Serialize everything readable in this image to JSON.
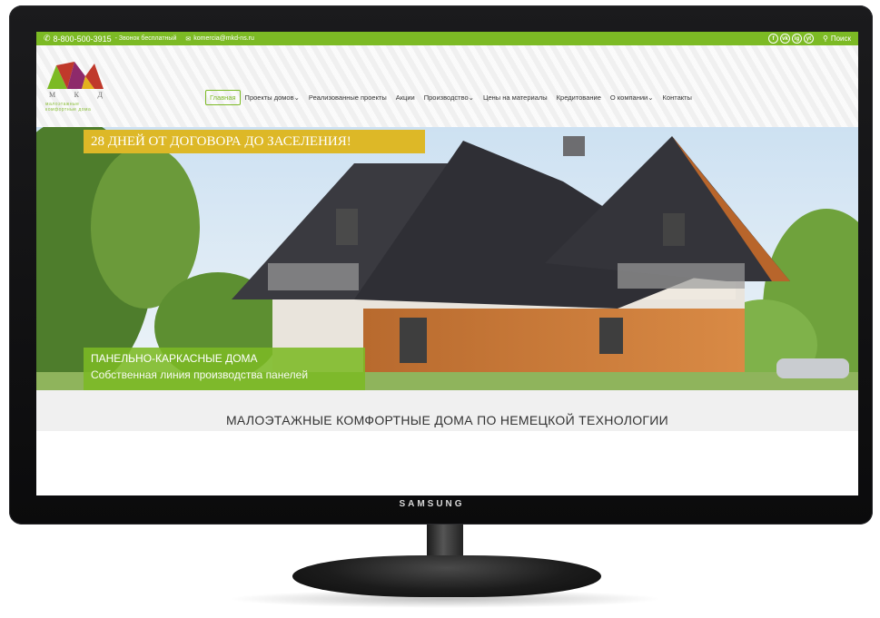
{
  "topbar": {
    "phone": "8-800-500-3915",
    "free_call": "- Звонок бесплатный",
    "email": "komercia@mkd-ns.ru",
    "social": [
      "f",
      "vk",
      "ig",
      "yt"
    ],
    "search_label": "Поиск"
  },
  "logo": {
    "letters": [
      "М",
      "К",
      "Д"
    ],
    "subtitle_line1": "малоэтажные",
    "subtitle_line2": "комфортные дома"
  },
  "nav": {
    "items": [
      {
        "label": "Главная"
      },
      {
        "label": "Проекты домов"
      },
      {
        "label": "Реализованные проекты"
      },
      {
        "label": "Акции"
      },
      {
        "label": "Производство"
      },
      {
        "label": "Цены на материалы"
      },
      {
        "label": "Кредитование"
      },
      {
        "label": "О компании"
      },
      {
        "label": "Контакты"
      }
    ],
    "dropdown_mark": "⌄"
  },
  "hero": {
    "banner_top": "28 ДНЕЙ ОТ ДОГОВОРА ДО ЗАСЕЛЕНИЯ!",
    "banner_line1": "ПАНЕЛЬНО-КАРКАСНЫЕ ДОМА",
    "banner_line2": "Собственная линия производства панелей"
  },
  "tagline": "МАЛОЭТАЖНЫЕ КОМФОРТНЫЕ ДОМА ПО НЕМЕЦКОЙ ТЕХНОЛОГИИ",
  "monitor": {
    "brand": "SAMSUNG"
  },
  "colors": {
    "brand_green": "#7cba24",
    "banner_yellow": "#ddb827",
    "logo_red": "#c0392b"
  }
}
